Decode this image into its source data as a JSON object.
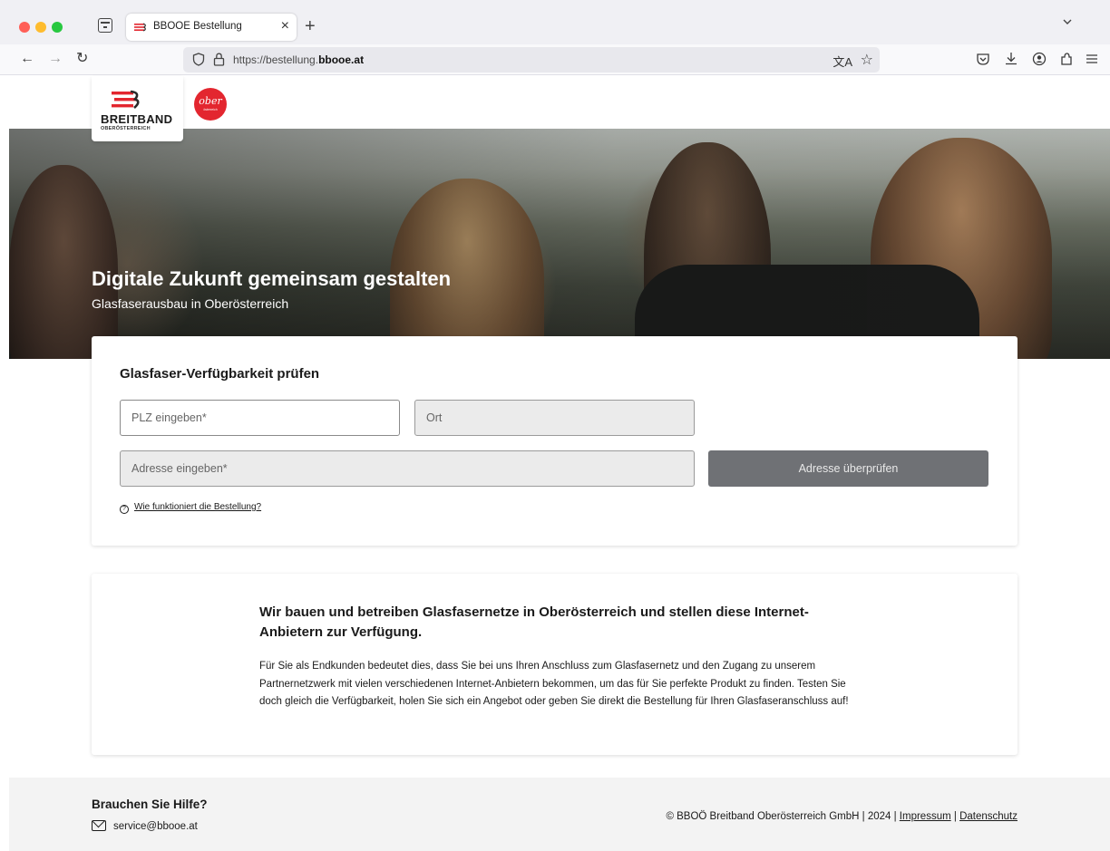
{
  "browser": {
    "tab_title": "BBOOE Bestellung",
    "url_prefix": "https://bestellung.",
    "url_domain": "bbooe.at"
  },
  "header": {
    "logo_word": "BREITBAND",
    "logo_sub": "OBERÖSTERREICH",
    "partner_logo_text": "ober",
    "partner_logo_sub": "österreich"
  },
  "hero": {
    "title": "Digitale Zukunft gemeinsam gestalten",
    "subtitle": "Glasfaserausbau in Oberösterreich"
  },
  "availability": {
    "title": "Glasfaser-Verfügbarkeit prüfen",
    "plz_placeholder": "PLZ eingeben*",
    "ort_placeholder": "Ort",
    "address_placeholder": "Adresse eingeben*",
    "check_button": "Adresse überprüfen",
    "howto_link": "Wie funktioniert die Bestellung?"
  },
  "info": {
    "heading": "Wir bauen und betreiben Glasfasernetze in Oberösterreich und stellen diese Internet-Anbietern zur Verfügung.",
    "body": "Für Sie als Endkunden bedeutet dies, dass Sie bei uns Ihren Anschluss zum Glasfasernetz und den Zugang zu unserem Partnernetzwerk mit vielen verschiedenen Internet-Anbietern bekommen, um das für Sie perfekte Produkt zu finden. Testen Sie doch gleich die Verfügbarkeit, holen Sie sich ein Angebot oder geben Sie direkt die Bestellung für Ihren Glasfaseranschluss auf!"
  },
  "footer": {
    "help_title": "Brauchen Sie Hilfe?",
    "email": "service@bbooe.at",
    "copyright": "© BBOÖ Breitband Oberösterreich GmbH | 2024 | ",
    "impressum": "Impressum",
    "separator": " | ",
    "datenschutz": "Datenschutz"
  },
  "colors": {
    "accent_red": "#e3262f",
    "button_gray": "#6f7175",
    "footer_bg": "#f3f3f3"
  },
  "icons": [
    "tab-overview-icon",
    "bbooe-favicon-icon",
    "close-icon",
    "plus-icon",
    "chevron-down-icon",
    "back-arrow-icon",
    "forward-arrow-icon",
    "reload-icon",
    "tracking-shield-icon",
    "lock-icon",
    "translate-icon",
    "bookmark-star-icon",
    "pocket-icon",
    "download-icon",
    "account-icon",
    "extensions-icon",
    "menu-icon",
    "help-circle-icon",
    "mail-icon"
  ]
}
